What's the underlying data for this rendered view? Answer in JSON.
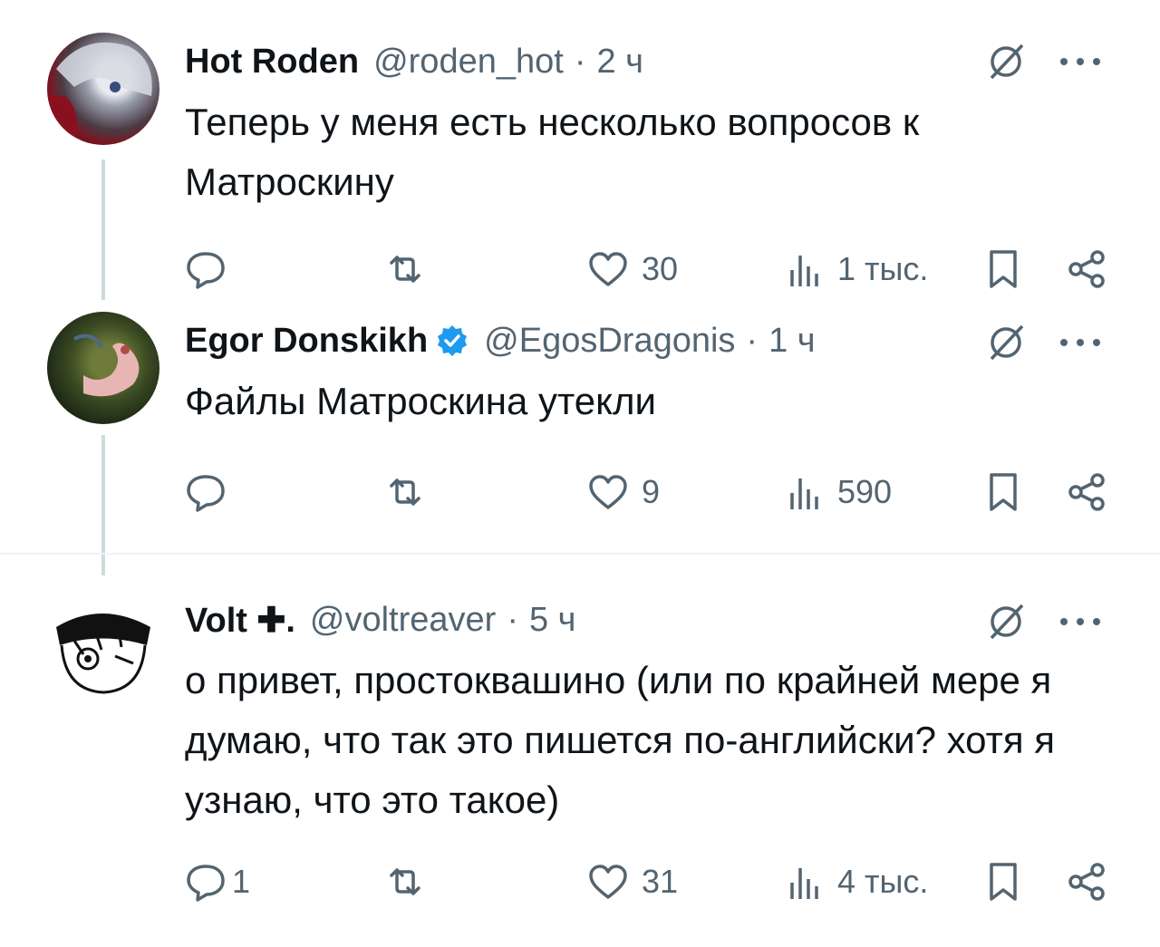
{
  "tweets": [
    {
      "name": "Hot Roden",
      "handle": "@roden_hot",
      "time": "2 ч",
      "text": "Теперь у меня есть несколько вопросов к Матроскину",
      "replies": "",
      "reposts": "",
      "likes": "30",
      "views": "1 тыс."
    },
    {
      "name": "Egor Donskikh",
      "handle": "@EgosDragonis",
      "time": "1 ч",
      "verified": true,
      "text": "Файлы Матроскина утекли",
      "replies": "",
      "reposts": "",
      "likes": "9",
      "views": "590"
    },
    {
      "name": "Volt ✚.",
      "handle": "@voltreaver",
      "time": "5 ч",
      "text": "о привет, простоквашино (или по крайней мере я думаю, что так это пишется по-английски? хотя я узнаю, что это такое)",
      "replies": "1",
      "reposts": "",
      "likes": "31",
      "views": "4 тыс."
    }
  ],
  "separator": "·",
  "colors": {
    "text": "#0f1419",
    "secondary": "#536471",
    "verified": "#1d9bf0",
    "thread_line": "#cfd9de"
  },
  "icons": [
    "reply-icon",
    "repost-icon",
    "like-icon",
    "views-icon",
    "bookmark-icon",
    "share-icon",
    "grok-icon",
    "more-icon",
    "verified-badge-icon"
  ]
}
